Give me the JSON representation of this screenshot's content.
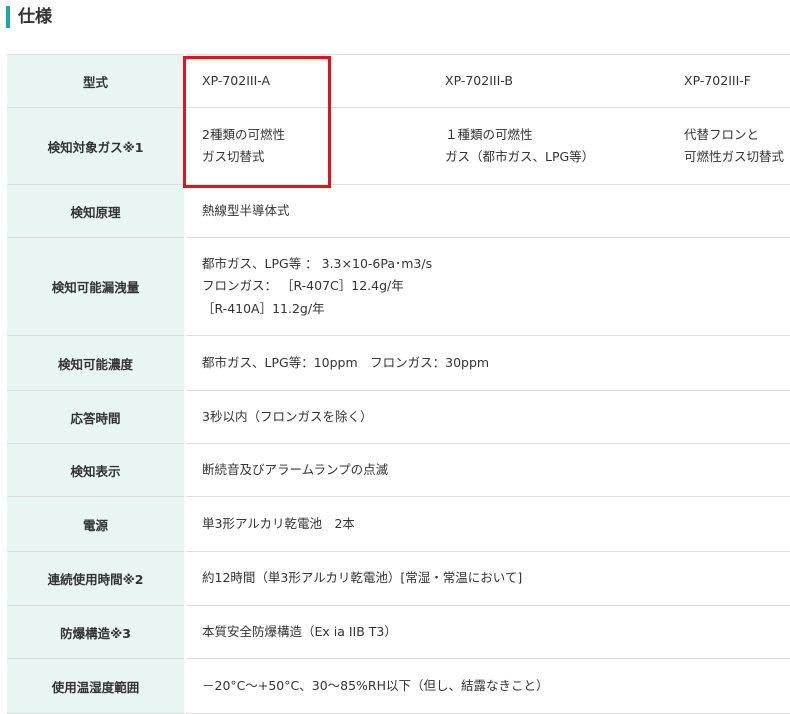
{
  "section": {
    "title": "仕様",
    "accent_color": "#19a6b3"
  },
  "table": {
    "header_bg": "#e9f5f3",
    "rows": {
      "model": {
        "label": "型式",
        "values": [
          "XP-702III-A",
          "XP-702III-B",
          "XP-702III-F"
        ]
      },
      "gas": {
        "label": "検知対象ガス※1",
        "values": [
          [
            "2種類の可燃性",
            "ガス切替式"
          ],
          [
            "１種類の可燃性",
            "ガス（都市ガス、LPG等）"
          ],
          [
            "代替フロンと",
            "可燃性ガス切替式"
          ]
        ]
      },
      "principle": {
        "label": "検知原理",
        "value": "熱線型半導体式"
      },
      "leak": {
        "label": "検知可能漏洩量",
        "lines": [
          "都市ガス、LPG等 ： 3.3×10-6Pa･m3/s",
          "フロンガス： ［R-407C］12.4g/年",
          "［R-410A］11.2g/年"
        ]
      },
      "concentration": {
        "label": "検知可能濃度",
        "value": "都市ガス、LPG等：10ppm　フロンガス：30ppm"
      },
      "response": {
        "label": "応答時間",
        "value": "3秒以内（フロンガスを除く）"
      },
      "display": {
        "label": "検知表示",
        "value": "断続音及びアラームランプの点滅"
      },
      "power": {
        "label": "電源",
        "value": "単3形アルカリ乾電池　2本"
      },
      "continuous": {
        "label": "連続使用時間※2",
        "value": "約12時間（単3形アルカリ乾電池）[常湿・常温において]"
      },
      "explosion": {
        "label": "防爆構造※3",
        "value": "本質安全防爆構造（Ex ia IIB T3）"
      },
      "temperature": {
        "label": "使用温湿度範囲",
        "value": "－20°C～+50°C、30～85%RH以下（但し、結露なきこと）"
      }
    }
  },
  "highlight": {
    "color": "#e4121a"
  }
}
